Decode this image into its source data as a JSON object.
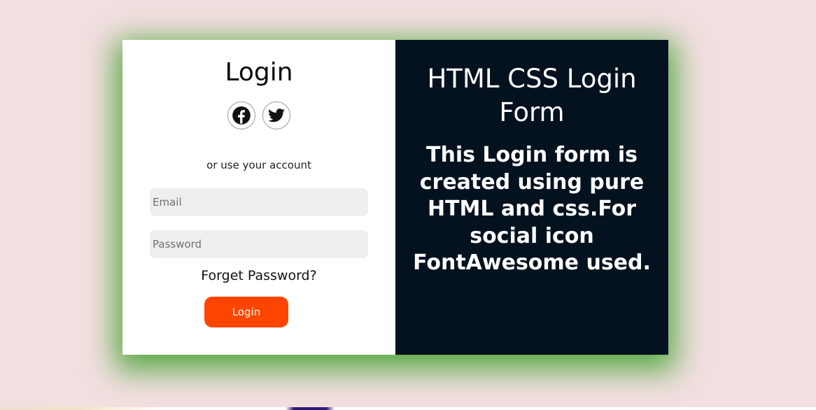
{
  "login": {
    "title": "Login",
    "social": {
      "facebook_icon": "facebook-icon",
      "twitter_icon": "twitter-icon"
    },
    "alt_text": "or use your account",
    "email_placeholder": "Email",
    "password_placeholder": "Password",
    "forget_password": "Forget Password?",
    "login_button": "Login"
  },
  "promo": {
    "title": "HTML CSS Login Form",
    "description": "This Login form is created using pure HTML and css.For social icon FontAwesome used."
  },
  "colors": {
    "page_background": "#f2dfe0",
    "panel_dark": "#04121f",
    "accent": "#ff4500",
    "shadow": "#3ca028"
  }
}
